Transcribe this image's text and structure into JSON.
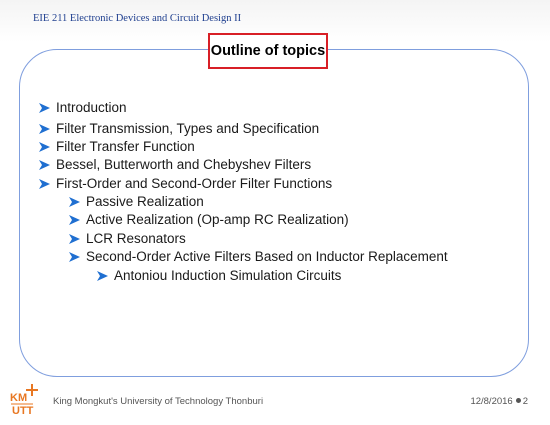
{
  "header": {
    "course_title": "EIE 211 Electronic Devices and Circuit Design II"
  },
  "slide": {
    "title": "Outline of topics",
    "topics": [
      "Introduction",
      "Filter Transmission, Types and Specification",
      "Filter Transfer Function",
      "Bessel, Butterworth and Chebyshev Filters",
      "First-Order and Second-Order Filter Functions",
      "Passive Realization",
      "Active Realization (Op-amp RC Realization)",
      "LCR Resonators",
      "Second-Order Active Filters Based on Inductor Replacement",
      "Antoniou Induction Simulation Circuits"
    ]
  },
  "footer": {
    "logo_text": "KMUTT",
    "university": "King Mongkut's University of Technology Thonburi",
    "date": "12/8/2016",
    "page_number": "2"
  },
  "colors": {
    "header_text": "#1f3f8f",
    "frame_border": "#7f9ede",
    "title_border": "#d81f26",
    "bullet_blue": "#1f6fd1",
    "logo_orange": "#e87722"
  },
  "icons": {
    "bullet": "arrow-bullet-icon",
    "logo": "kmutt-logo-icon"
  }
}
